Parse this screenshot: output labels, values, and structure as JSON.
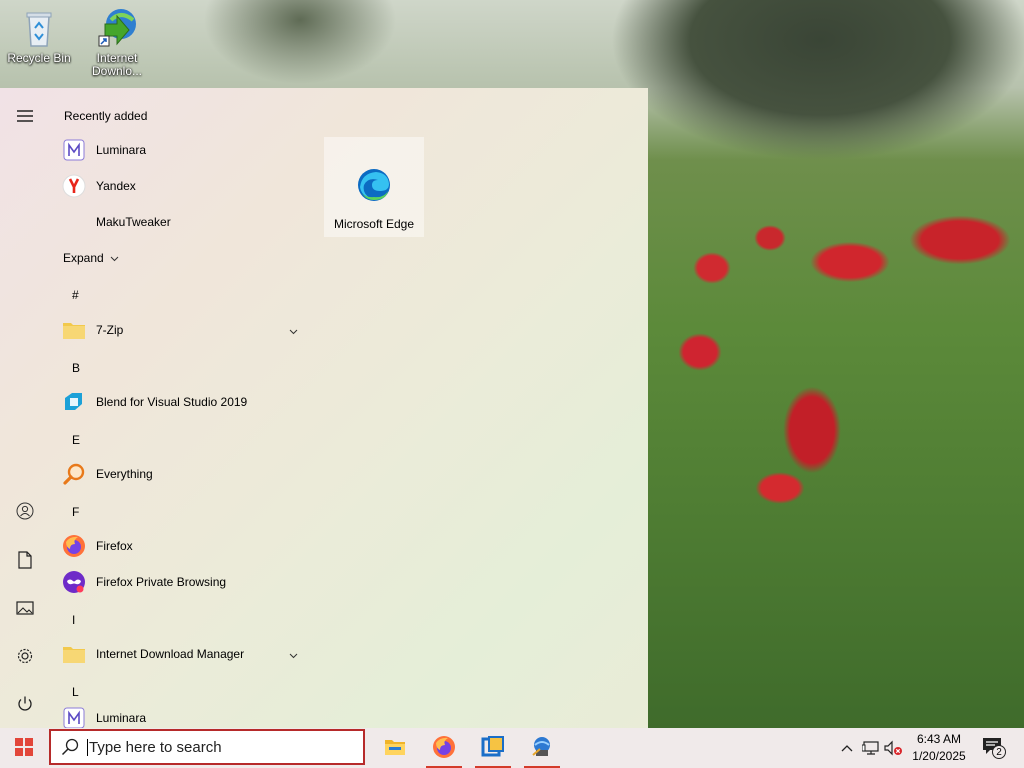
{
  "desktop": {
    "icons": [
      {
        "label": "Recycle Bin",
        "icon": "recycle-bin-icon"
      },
      {
        "label": "Internet Downlo...",
        "icon": "internet-download-manager-icon"
      }
    ]
  },
  "start_menu": {
    "recently_added_heading": "Recently added",
    "recent": [
      {
        "label": "Luminara",
        "icon": "luminara-icon"
      },
      {
        "label": "Yandex",
        "icon": "yandex-icon"
      },
      {
        "label": "MakuTweaker",
        "icon": ""
      }
    ],
    "expand_label": "Expand",
    "groups": [
      {
        "letter": "#",
        "apps": [
          {
            "label": "7-Zip",
            "icon": "folder-icon",
            "expandable": true
          }
        ]
      },
      {
        "letter": "B",
        "apps": [
          {
            "label": "Blend for Visual Studio 2019",
            "icon": "blend-icon",
            "expandable": false
          }
        ]
      },
      {
        "letter": "E",
        "apps": [
          {
            "label": "Everything",
            "icon": "everything-search-icon",
            "expandable": false
          }
        ]
      },
      {
        "letter": "F",
        "apps": [
          {
            "label": "Firefox",
            "icon": "firefox-icon",
            "expandable": false
          },
          {
            "label": "Firefox Private Browsing",
            "icon": "firefox-private-icon",
            "expandable": false
          }
        ]
      },
      {
        "letter": "I",
        "apps": [
          {
            "label": "Internet Download Manager",
            "icon": "folder-icon",
            "expandable": true
          }
        ]
      },
      {
        "letter": "L",
        "apps": [
          {
            "label": "Luminara",
            "icon": "luminara-icon",
            "expandable": false
          }
        ]
      }
    ],
    "tiles": [
      {
        "label": "Microsoft Edge",
        "icon": "edge-icon"
      }
    ],
    "rail": [
      "hamburger-menu-icon",
      "user-account-icon",
      "documents-icon",
      "pictures-icon",
      "settings-gear-icon",
      "power-icon"
    ]
  },
  "taskbar": {
    "start_icon": "windows-logo-icon",
    "search_placeholder": "Type here to search",
    "pinned": [
      "file-explorer-icon",
      "firefox-icon",
      "virtualbox-icon",
      "network-app-icon"
    ],
    "tray": {
      "chevron": "show-hidden-icons-chevron",
      "network": "network-icon",
      "volume": "volume-muted-icon",
      "time": "6:43 AM",
      "date": "1/20/2025",
      "notifications_count": "2"
    }
  },
  "colors": {
    "taskbar_bg": "#f0eaea",
    "search_border": "#b62a2a",
    "active_underline": "#d33b2a"
  }
}
